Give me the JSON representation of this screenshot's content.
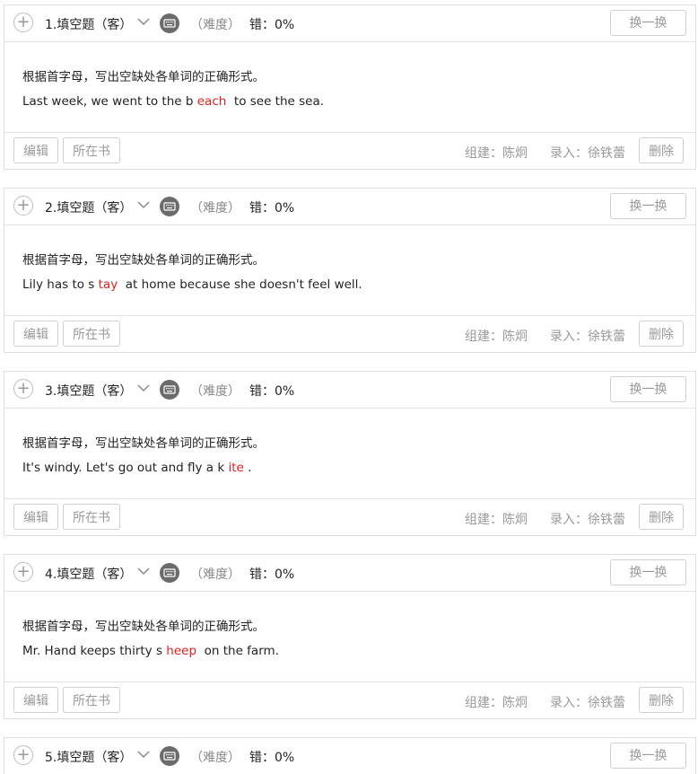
{
  "questions": [
    {
      "title": "1.填空题（客）",
      "difficulty": "（难度）",
      "error": "错：0%",
      "swap_label": "换一换",
      "instruction": "根据首字母，写出空缺处各单词的正确形式。",
      "before": "Last week, we went to the b ",
      "answer": "each",
      "after": "  to see the sea.",
      "edit_label": "编辑",
      "book_label": "所在书",
      "builder": "组建：陈炯",
      "recorder": "录入：徐铁蕾",
      "delete_label": "删除"
    },
    {
      "title": "2.填空题（客）",
      "difficulty": "（难度）",
      "error": "错：0%",
      "swap_label": "换一换",
      "instruction": "根据首字母，写出空缺处各单词的正确形式。",
      "before": "Lily has to s ",
      "answer": "tay",
      "after": "  at home because she doesn't feel well.",
      "edit_label": "编辑",
      "book_label": "所在书",
      "builder": "组建：陈炯",
      "recorder": "录入：徐铁蕾",
      "delete_label": "删除"
    },
    {
      "title": "3.填空题（客）",
      "difficulty": "（难度）",
      "error": "错：0%",
      "swap_label": "换一换",
      "instruction": "根据首字母，写出空缺处各单词的正确形式。",
      "before": "It's windy. Let's go out and fly a k ",
      "answer": "ite",
      "after": " .",
      "edit_label": "编辑",
      "book_label": "所在书",
      "builder": "组建：陈炯",
      "recorder": "录入：徐铁蕾",
      "delete_label": "删除"
    },
    {
      "title": "4.填空题（客）",
      "difficulty": "（难度）",
      "error": "错：0%",
      "swap_label": "换一换",
      "instruction": "根据首字母，写出空缺处各单词的正确形式。",
      "before": "Mr. Hand keeps thirty s ",
      "answer": "heep",
      "after": "  on the farm.",
      "edit_label": "编辑",
      "book_label": "所在书",
      "builder": "组建：陈炯",
      "recorder": "录入：徐铁蕾",
      "delete_label": "删除"
    },
    {
      "title": "5.填空题（客）",
      "difficulty": "（难度）",
      "error": "错：0%",
      "swap_label": "换一换"
    }
  ],
  "icons": {
    "add": "plus-circle-icon",
    "expand": "chevron-down-icon",
    "keyboard": "keyboard-icon"
  },
  "colors": {
    "answer": "#e02020",
    "muted": "#9a9a9a",
    "keyboard_icon": "#6b6b6b"
  }
}
